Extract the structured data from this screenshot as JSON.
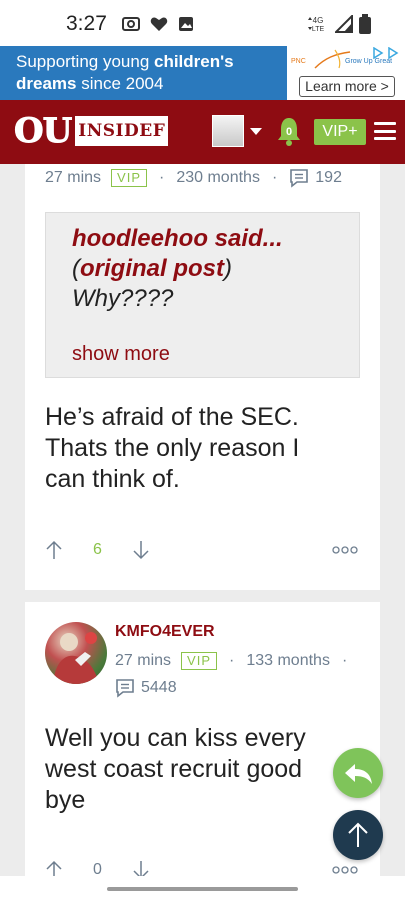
{
  "status_bar": {
    "time": "3:27",
    "network": "4G LTE"
  },
  "ad": {
    "line1_prefix": "Supporting young ",
    "line1_bold": "children's",
    "line2_bold": "dreams",
    "line2_suffix": " since 2004",
    "brand_left": "PNC",
    "brand_right": "Grow Up Great",
    "cta": "Learn more >"
  },
  "header": {
    "logo_ou": "OU",
    "logo_inside": "INSIDEF",
    "notification_count": "0",
    "vip_button": "VIP+"
  },
  "post1": {
    "time_ago": "27 mins",
    "vip_tag": "VIP",
    "member_for": "230 months",
    "comment_count": "192",
    "quote_author": "hoodleehoo said...",
    "quote_original_open": "(",
    "quote_original_link": "original post",
    "quote_original_close": ")",
    "quote_text": "Why????",
    "show_more": "show more",
    "body": "He’s afraid of the SEC. Thats the only reason I can think of.",
    "vote_count": "6"
  },
  "post2": {
    "username": "KMFO4EVER",
    "time_ago": "27 mins",
    "vip_tag": "VIP",
    "member_for": "133 months",
    "comment_count": "5448",
    "body": "Well you can kiss every west coast recruit good bye",
    "vote_count": "0"
  },
  "colors": {
    "brand_red": "#8e0c12",
    "vip_green": "#8bc34a",
    "ad_blue": "#2a79bd",
    "fab_dark": "#1f3a4f"
  }
}
